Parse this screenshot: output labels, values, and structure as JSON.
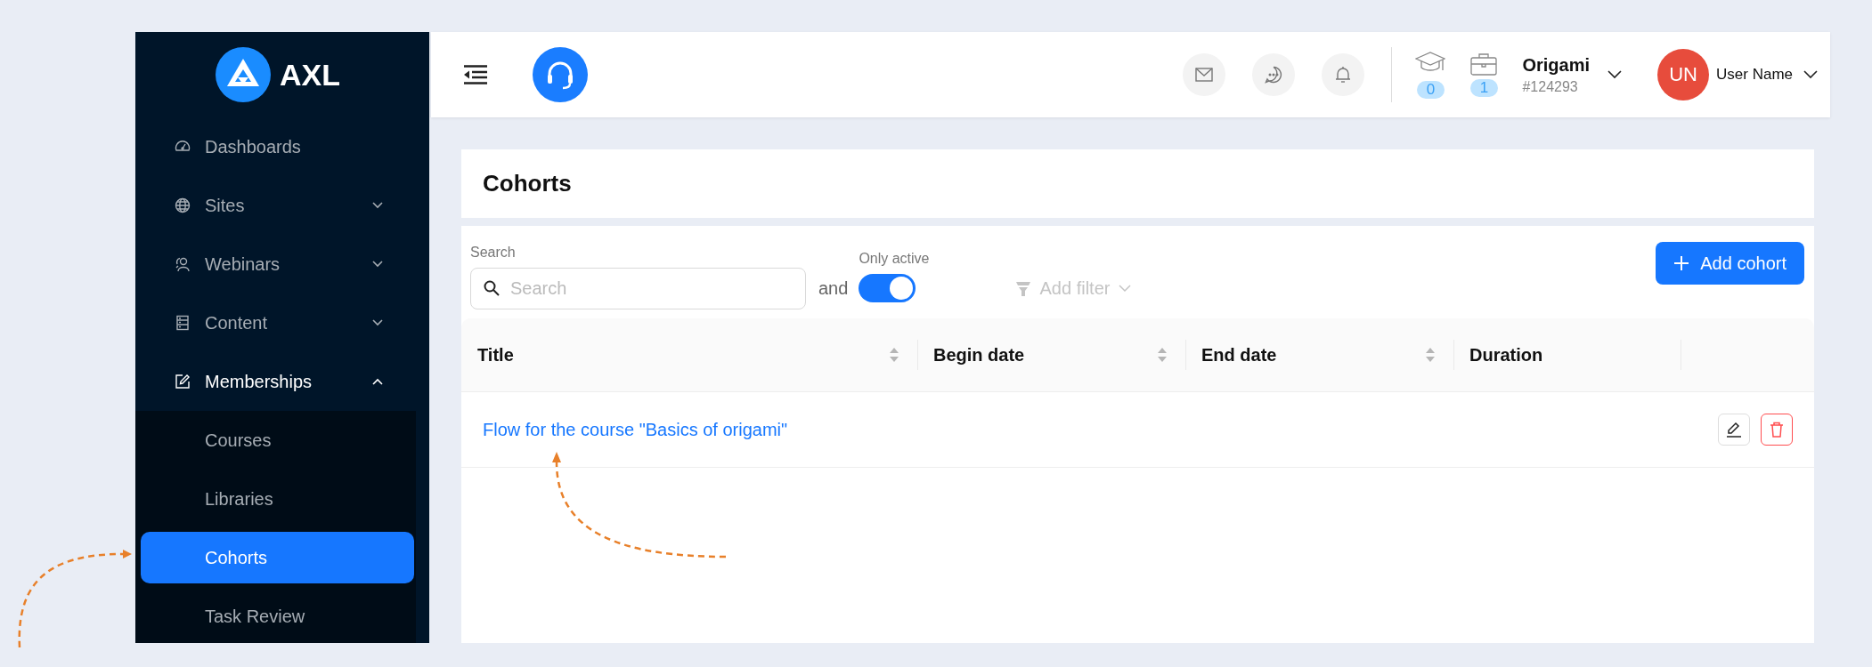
{
  "sidebar": {
    "logo": {
      "text": "AXL"
    },
    "items": [
      {
        "label": "Dashboards",
        "kind": "link"
      },
      {
        "label": "Sites",
        "kind": "group",
        "expanded": false
      },
      {
        "label": "Webinars",
        "kind": "group",
        "expanded": false
      },
      {
        "label": "Content",
        "kind": "group",
        "expanded": false
      },
      {
        "label": "Memberships",
        "kind": "group",
        "expanded": true,
        "children": [
          {
            "label": "Courses",
            "selected": false
          },
          {
            "label": "Libraries",
            "selected": false
          },
          {
            "label": "Cohorts",
            "selected": true
          },
          {
            "label": "Task Review",
            "selected": false
          }
        ]
      }
    ]
  },
  "header": {
    "counters": [
      {
        "count": "0"
      },
      {
        "count": "1"
      }
    ],
    "account": {
      "name": "Origami",
      "id": "#124293"
    },
    "user": {
      "initials": "UN",
      "name": "User Name"
    }
  },
  "page": {
    "title": "Cohorts"
  },
  "filters": {
    "search": {
      "label": "Search",
      "placeholder": "Search"
    },
    "joiner": "and",
    "only_active": {
      "label": "Only active",
      "on": true
    },
    "add_filter": {
      "label": "Add filter",
      "disabled": true
    },
    "add_button": "Add cohort"
  },
  "table": {
    "columns": [
      {
        "label": "Title",
        "sortable": true
      },
      {
        "label": "Begin date",
        "sortable": true
      },
      {
        "label": "End date",
        "sortable": true
      },
      {
        "label": "Duration",
        "sortable": false
      }
    ],
    "rows": [
      {
        "title": "Flow for the course \"Basics of origami\""
      }
    ]
  }
}
